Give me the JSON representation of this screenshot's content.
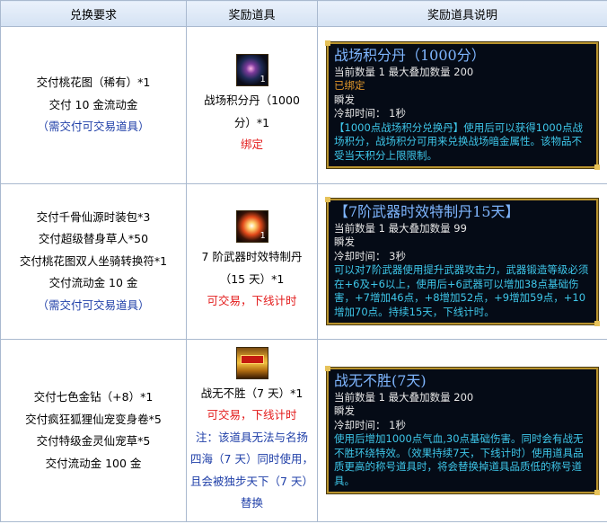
{
  "headers": [
    "兑换要求",
    "奖励道具",
    "奖励道具说明"
  ],
  "rows": [
    {
      "requirements": [
        "交付桃花图（稀有）*1",
        "交付 10 金流动金"
      ],
      "requirements_note": "（需交付可交易道具）",
      "item_icon": "jade-orb-icon",
      "item_qty": "1",
      "item_lines": [
        "战场积分丹（1000",
        "分）*1"
      ],
      "item_status": "绑定",
      "item_note": "",
      "tooltip": {
        "title": "战场积分丹（1000分）",
        "stats": "当前数量 1 最大叠加数量 200",
        "bound": "已绑定",
        "cast": "瞬发",
        "cooldown": "冷却时间： 1秒",
        "desc": "【1000点战场积分兑换丹】使用后可以获得1000点战场积分，战场积分可用来兑换战场暗金属性。该物品不受当天积分上限限制。"
      }
    },
    {
      "requirements": [
        "交付千骨仙源时装包*3",
        "交付超级替身草人*50",
        "交付桃花图双人坐骑转换符*1",
        "交付流动金 10 金"
      ],
      "requirements_note": "（需交付可交易道具）",
      "item_icon": "fire-pill-icon",
      "item_qty": "1",
      "item_lines": [
        "7 阶武器时效特制丹",
        "（15 天）*1"
      ],
      "item_status": "可交易，下线计时",
      "item_note": "",
      "tooltip": {
        "title": "【7阶武器时效特制丹15天】",
        "stats": "当前数量 1 最大叠加数量 99",
        "bound": "",
        "cast": "瞬发",
        "cooldown": "冷却时间： 3秒",
        "desc": "可以对7阶武器使用提升武器攻击力，武器锻造等级必须在+6及+6以上，使用后+6武器可以增加38点基础伤害，+7增加46点，+8增加52点，+9增加59点，+10增加70点。持续15天，下线计时。"
      }
    },
    {
      "requirements": [
        "交付七色金钻（+8）*1",
        "交付疯狂狐狸仙宠变身卷*5",
        "交付特级金灵仙宠草*5",
        "交付流动金 100 金"
      ],
      "requirements_note": "",
      "item_icon": "golden-title-scroll-icon",
      "item_qty": "",
      "item_lines": [
        "战无不胜（7 天）*1"
      ],
      "item_status": "可交易，下线计时",
      "item_note": "注：该道具无法与名扬四海（7 天）同时使用，且会被独步天下（7 天）替换",
      "tooltip": {
        "title": "战无不胜(7天)",
        "stats": "当前数量 1 最大叠加数量 200",
        "bound": "",
        "cast": "瞬发",
        "cooldown": "冷却时间： 1秒",
        "desc": "使用后增加1000点气血,30点基础伤害。同时会有战无不胜环绕特效。（效果持续7天，下线计时）使用道具品质更高的称号道具时，将会替换掉道具品质低的称号道具。"
      }
    }
  ],
  "colors": {
    "header_bg": "#d4e2f3",
    "border": "#a9b9cf",
    "note_blue": "#1f3fa8",
    "status_red": "#e31b1b",
    "tooltip_bg": "#050b16",
    "tooltip_title": "#7fb6ff",
    "tooltip_desc": "#3ec7ea",
    "tooltip_bound": "#e0962a"
  }
}
